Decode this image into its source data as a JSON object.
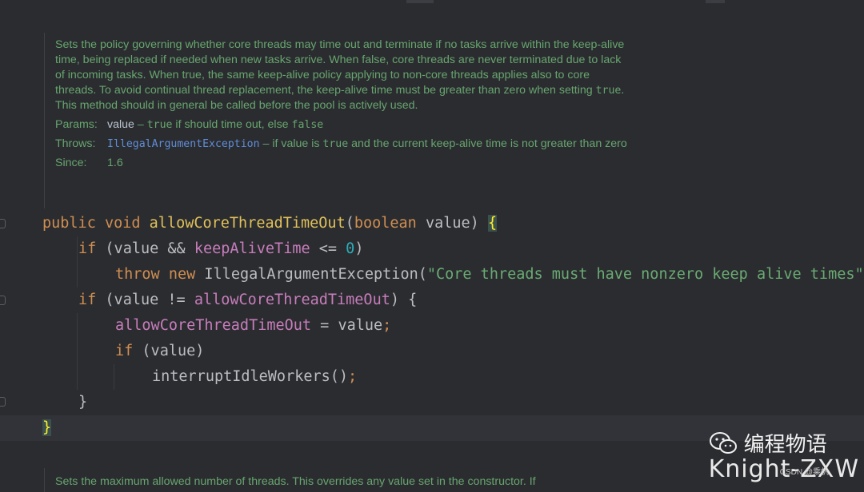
{
  "doc_comment": {
    "description_parts": [
      "Sets the policy governing whether core threads may time out and terminate if no tasks arrive within the keep-alive time, being replaced if needed when new tasks arrive. When false, core threads are never terminated due to lack of incoming tasks. When true, the same keep-alive policy applying to non-core threads applies also to core threads. To avoid continual thread replacement, the keep-alive time must be greater than zero when setting ",
      "true",
      ". This method should in general be called before the pool is actively used."
    ],
    "params": {
      "label": "Params:",
      "name": "value",
      "dash": " – ",
      "code": "true",
      "text_mid": " if should time out, else ",
      "code2": "false"
    },
    "throws": {
      "label": "Throws:",
      "exception": "IllegalArgumentException",
      "text1": " – if value is ",
      "code": "true",
      "text2": " and the current keep-alive time is not greater than zero"
    },
    "since": {
      "label": "Since:",
      "value": "1.6"
    }
  },
  "code": {
    "l1": {
      "kw1": "public",
      "kw2": "void",
      "method": "allowCoreThreadTimeOut",
      "open": "(",
      "type": "boolean",
      "param": " value) ",
      "brace": "{"
    },
    "l2": {
      "kw": "if",
      "a": " (value && ",
      "field": "keepAliveTime",
      "b": " <= ",
      "num": "0",
      "c": ")"
    },
    "l3": {
      "kw1": "throw",
      "kw2": "new",
      "cls": " IllegalArgumentException(",
      "str": "\"Core threads must have nonzero keep alive times\");"
    },
    "l4": {
      "kw": "if",
      "a": " (value != ",
      "field": "allowCoreThreadTimeOut",
      "b": ") {"
    },
    "l5": {
      "field": "allowCoreThreadTimeOut",
      "a": " = value",
      "semi": ";"
    },
    "l6": {
      "kw": "if",
      "a": " (value)"
    },
    "l7": {
      "call": "interruptIdleWorkers()",
      "semi": ";"
    },
    "l8": {
      "text": "}"
    },
    "l9": {
      "text": "}"
    }
  },
  "doc_comment_2": {
    "text": "Sets the maximum allowed number of threads. This overrides any value set in the constructor. If"
  },
  "watermark": {
    "icon": "wechat-icon",
    "title": "编程物语",
    "name": "Knight-ZXW",
    "small": "CSDN @乘帆"
  }
}
